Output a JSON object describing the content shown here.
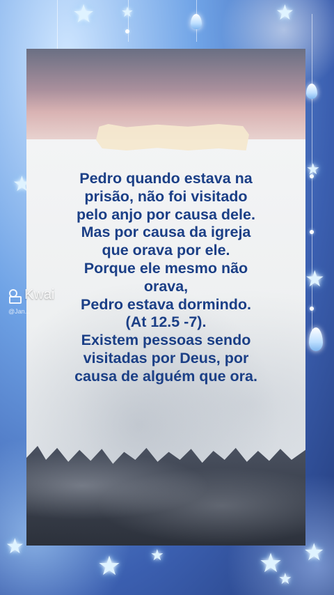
{
  "post": {
    "verse_text": "Pedro quando estava na\nprisão, não foi visitado\npelo anjo por causa dele.\nMas por causa da igreja\nque orava por ele.\nPorque ele mesmo não\norava,\nPedro estava dormindo.\n(At 12.5 -7).\nExistem pessoas sendo\nvisitadas por Deus, por\ncausa de alguém que ora."
  },
  "watermark": {
    "brand": "Kwai",
    "user": "@Jan...",
    "icon": "kwai-logo-icon"
  },
  "colors": {
    "text": "#1b3f86",
    "frame_blue": "#6fa3e6"
  }
}
